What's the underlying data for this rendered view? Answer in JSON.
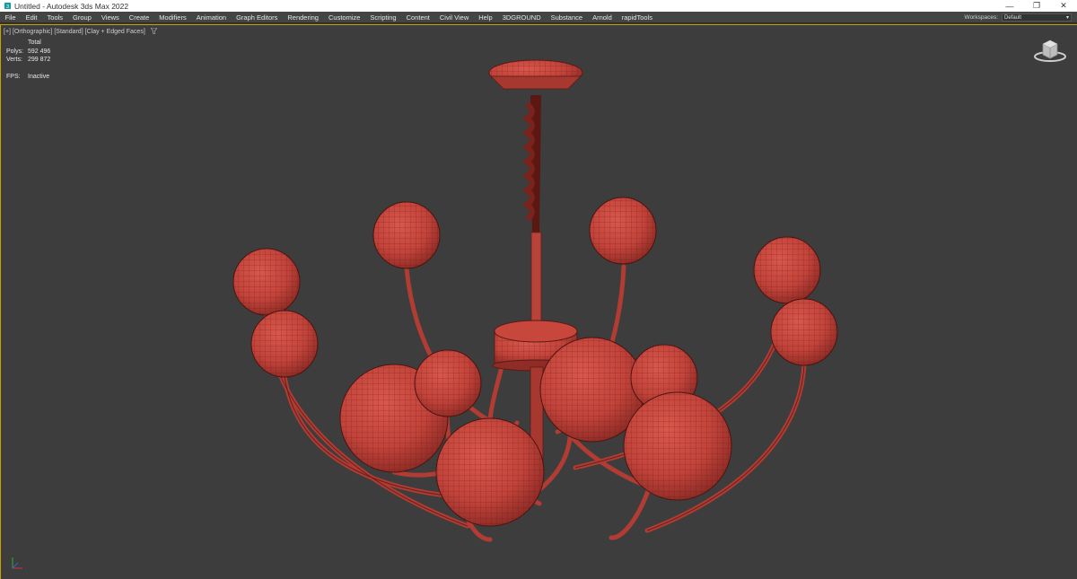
{
  "titlebar": {
    "title": "Untitled - Autodesk 3ds Max 2022",
    "minimize": "—",
    "restore": "❐",
    "close": "✕"
  },
  "menu": {
    "items": [
      "File",
      "Edit",
      "Tools",
      "Group",
      "Views",
      "Create",
      "Modifiers",
      "Animation",
      "Graph Editors",
      "Rendering",
      "Customize",
      "Scripting",
      "Content",
      "Civil View",
      "Help",
      "3DGROUND",
      "Substance",
      "Arnold",
      "rapidTools"
    ]
  },
  "workspace": {
    "label": "Workspaces:",
    "value": "Default"
  },
  "viewport": {
    "label_plus": "[+]",
    "label_view": "[Orthographic]",
    "label_shading": "[Standard]",
    "label_mode": "[Clay + Edged Faces]"
  },
  "stats": {
    "header": "Total",
    "polys_label": "Polys:",
    "polys_value": "592 496",
    "verts_label": "Verts:",
    "verts_value": "299 872",
    "fps_label": "FPS:",
    "fps_value": "Inactive"
  },
  "icons": {
    "app": "3dsmax-icon",
    "filter": "filter-icon",
    "viewcube": "viewcube-icon",
    "axis": "axis-tripod-icon"
  },
  "colors": {
    "accent": "#c9a100",
    "clay": "#c9453c",
    "background": "#3d3d3d"
  }
}
